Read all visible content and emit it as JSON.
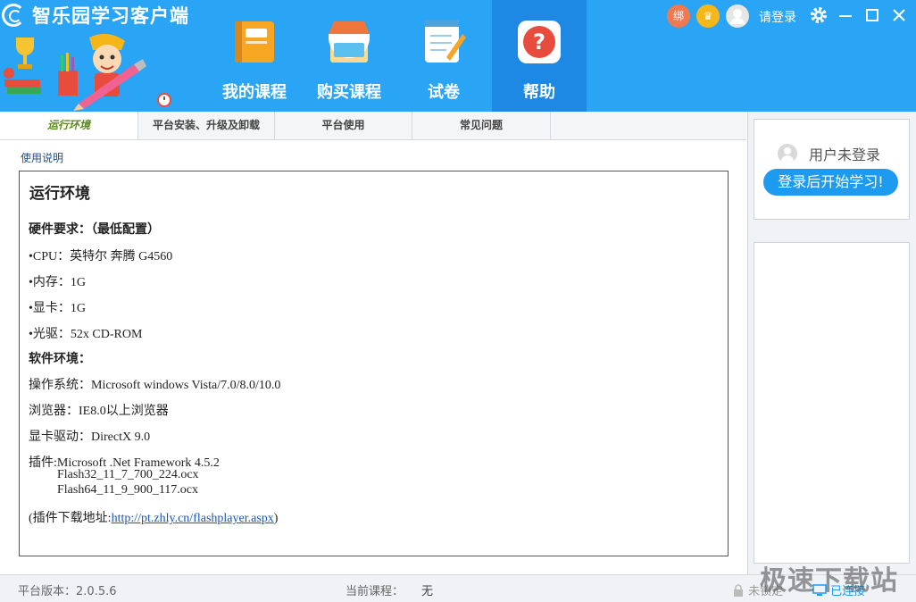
{
  "app": {
    "title": "智乐园学习客户端"
  },
  "nav": [
    {
      "label": "我的课程",
      "icon": "course-book-icon"
    },
    {
      "label": "购买课程",
      "icon": "shop-icon"
    },
    {
      "label": "试卷",
      "icon": "exam-paper-icon"
    },
    {
      "label": "帮助",
      "icon": "help-icon"
    }
  ],
  "topbar": {
    "bind_badge": "绑",
    "login": "请登录"
  },
  "subtabs": [
    {
      "label": "运行环境",
      "active": true
    },
    {
      "label": "平台安装、升级及卸载",
      "active": false
    },
    {
      "label": "平台使用",
      "active": false
    },
    {
      "label": "常见问题",
      "active": false
    }
  ],
  "main": {
    "usage_link": "使用说明",
    "title": "运行环境",
    "hw_heading": "硬件要求：（最低配置）",
    "cpu": "•CPU：英特尔  奔腾   G4560",
    "memory": "•内存：1G",
    "gpu": "•显卡：1G",
    "drive": "•光驱：52x CD-ROM",
    "sw_heading": "软件环境：",
    "os": "操作系统：Microsoft windows Vista/7.0/8.0/10.0",
    "browser": "浏览器：IE8.0以上浏览器",
    "driver": "显卡驱动：DirectX 9.0",
    "plugin_label": "插件:",
    "plugin_1": "Microsoft .Net Framework 4.5.2",
    "plugin_2": "Flash32_11_7_700_224.ocx",
    "plugin_3": "Flash64_11_9_900_117.ocx",
    "download_prefix": "(插件下载地址:",
    "download_url": "http://pt.zhly.cn/flashplayer.aspx",
    "download_suffix": ")"
  },
  "side": {
    "user_status": "用户未登录",
    "login_button": "登录后开始学习!"
  },
  "status": {
    "version_label": "平台版本：",
    "version": "2.0.5.6",
    "course_label": "当前课程：",
    "course": "无",
    "lock_state": "未锁定",
    "conn_state": "已连接"
  },
  "watermark": "极速下载站",
  "colors": {
    "header": "#2aa4f4",
    "active_nav": "#1e88e5",
    "button": "#1d9bf0"
  }
}
